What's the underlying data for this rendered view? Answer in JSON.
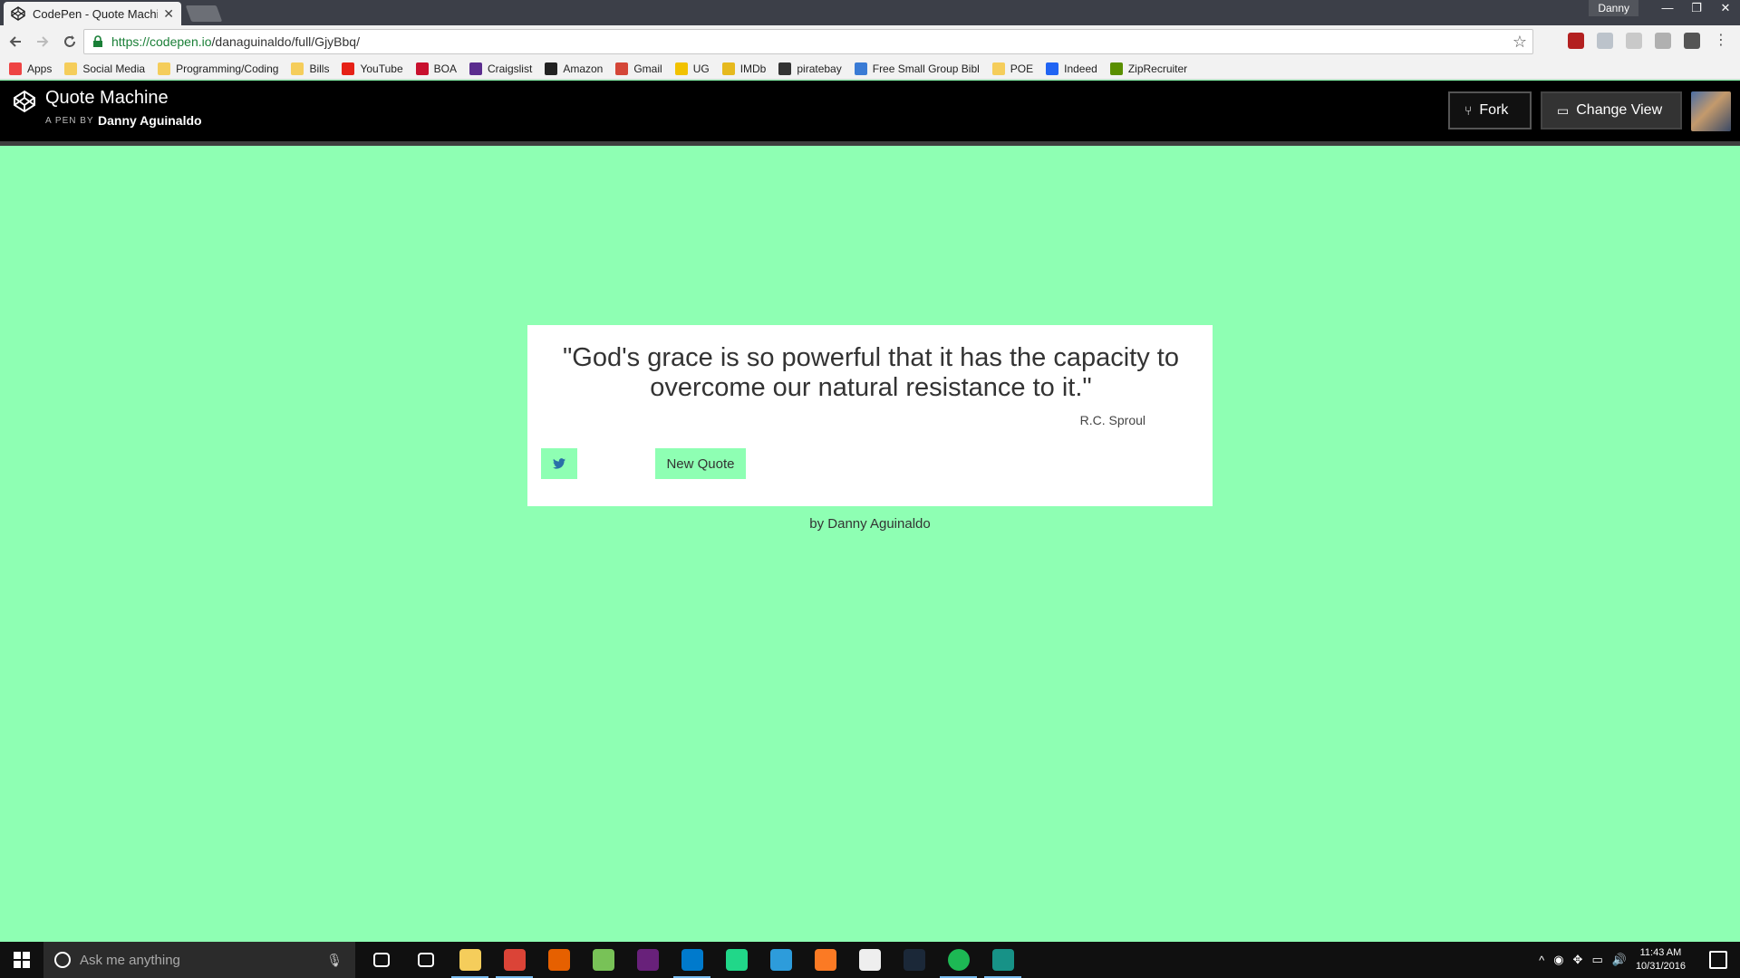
{
  "browser": {
    "tab_title": "CodePen - Quote Machine",
    "tab_close": "✕",
    "profile_name": "Danny",
    "window_controls": [
      "—",
      "❐",
      "✕"
    ],
    "url_host": "https://codepen.io",
    "url_path": "/danaguinaldo/full/GjyBbq/",
    "bookmarks": [
      {
        "label": "Apps",
        "icon": "apps-grid-icon",
        "color": "#e44"
      },
      {
        "label": "Social Media",
        "icon": "folder-icon",
        "color": "#f5cd5b"
      },
      {
        "label": "Programming/Coding",
        "icon": "folder-icon",
        "color": "#f5cd5b"
      },
      {
        "label": "Bills",
        "icon": "folder-icon",
        "color": "#f5cd5b"
      },
      {
        "label": "YouTube",
        "icon": "youtube-icon",
        "color": "#e62117"
      },
      {
        "label": "BOA",
        "icon": "boa-icon",
        "color": "#c8102e"
      },
      {
        "label": "Craigslist",
        "icon": "peace-icon",
        "color": "#5b2d8e"
      },
      {
        "label": "Amazon",
        "icon": "amazon-icon",
        "color": "#222"
      },
      {
        "label": "Gmail",
        "icon": "gmail-icon",
        "color": "#d44638"
      },
      {
        "label": "UG",
        "icon": "ug-icon",
        "color": "#f2c200"
      },
      {
        "label": "IMDb",
        "icon": "imdb-icon",
        "color": "#e6b91e"
      },
      {
        "label": "piratebay",
        "icon": "pirate-ship-icon",
        "color": "#333"
      },
      {
        "label": "Free Small Group Bibl",
        "icon": "w-icon",
        "color": "#3a7bd5"
      },
      {
        "label": "POE",
        "icon": "folder-icon",
        "color": "#f5cd5b"
      },
      {
        "label": "Indeed",
        "icon": "indeed-icon",
        "color": "#2164f3"
      },
      {
        "label": "ZipRecruiter",
        "icon": "ziprecruiter-icon",
        "color": "#5a8f00"
      }
    ]
  },
  "codepen": {
    "title": "Quote Machine",
    "by_label": "A PEN BY",
    "author": "Danny Aguinaldo",
    "fork_label": "Fork",
    "change_view_label": "Change View"
  },
  "quote_card": {
    "quote": "\"God's grace is so powerful that it has the capacity to overcome our natural resistance to it.\"",
    "author": "R.C. Sproul",
    "new_quote_label": "New Quote",
    "tweet_icon": "twitter-icon"
  },
  "byline": "by Danny Aguinaldo",
  "taskbar": {
    "search_placeholder": "Ask me anything",
    "time": "11:43 AM",
    "date": "10/31/2016",
    "apps": [
      {
        "name": "task-view-icon",
        "color": "#101010"
      },
      {
        "name": "store-icon",
        "color": "#101010"
      },
      {
        "name": "file-explorer-icon",
        "color": "#f5cd5b"
      },
      {
        "name": "chrome-icon",
        "color": "#db4437"
      },
      {
        "name": "firefox-icon",
        "color": "#e66000"
      },
      {
        "name": "android-studio-icon",
        "color": "#78c257"
      },
      {
        "name": "visual-studio-icon",
        "color": "#68217a"
      },
      {
        "name": "vscode-icon",
        "color": "#007acc"
      },
      {
        "name": "pycharm-icon",
        "color": "#21d789"
      },
      {
        "name": "brackets-icon",
        "color": "#2d9cdb"
      },
      {
        "name": "xampp-icon",
        "color": "#fb7a24"
      },
      {
        "name": "unity-icon",
        "color": "#eeeeee"
      },
      {
        "name": "steam-icon",
        "color": "#1b2838"
      },
      {
        "name": "spotify-icon",
        "color": "#1db954"
      },
      {
        "name": "gitkraken-icon",
        "color": "#179287"
      }
    ]
  },
  "colors": {
    "page_background": "#8effb3",
    "header_background": "#000000",
    "card_background": "#ffffff",
    "button_background": "#8effb3"
  }
}
